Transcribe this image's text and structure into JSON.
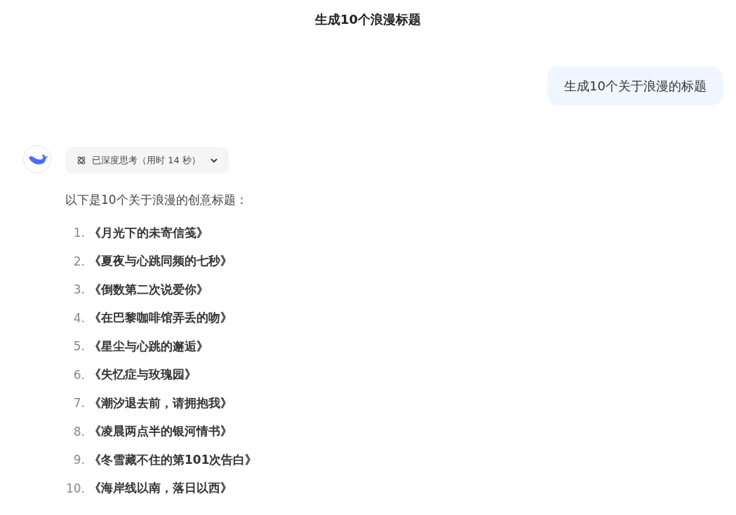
{
  "header": {
    "title": "生成10个浪漫标题"
  },
  "user_message": {
    "text": "生成10个关于浪漫的标题"
  },
  "assistant": {
    "thinking": {
      "label": "已深度思考（用时 14 秒）",
      "expanded": false
    },
    "intro": "以下是10个关于浪漫的创意标题：",
    "items": [
      {
        "number": "1.",
        "title": "《月光下的未寄信笺》"
      },
      {
        "number": "2.",
        "title": "《夏夜与心跳同频的七秒》"
      },
      {
        "number": "3.",
        "title": "《倒数第二次说爱你》"
      },
      {
        "number": "4.",
        "title": "《在巴黎咖啡馆弄丢的吻》"
      },
      {
        "number": "5.",
        "title": "《星尘与心跳的邂逅》"
      },
      {
        "number": "6.",
        "title": "《失忆症与玫瑰园》"
      },
      {
        "number": "7.",
        "title": "《潮汐退去前，请拥抱我》"
      },
      {
        "number": "8.",
        "title": "《凌晨两点半的银河情书》"
      },
      {
        "number": "9.",
        "title": "《冬雪藏不住的第101次告白》"
      },
      {
        "number": "10.",
        "title": "《海岸线以南，落日以西》"
      }
    ]
  }
}
